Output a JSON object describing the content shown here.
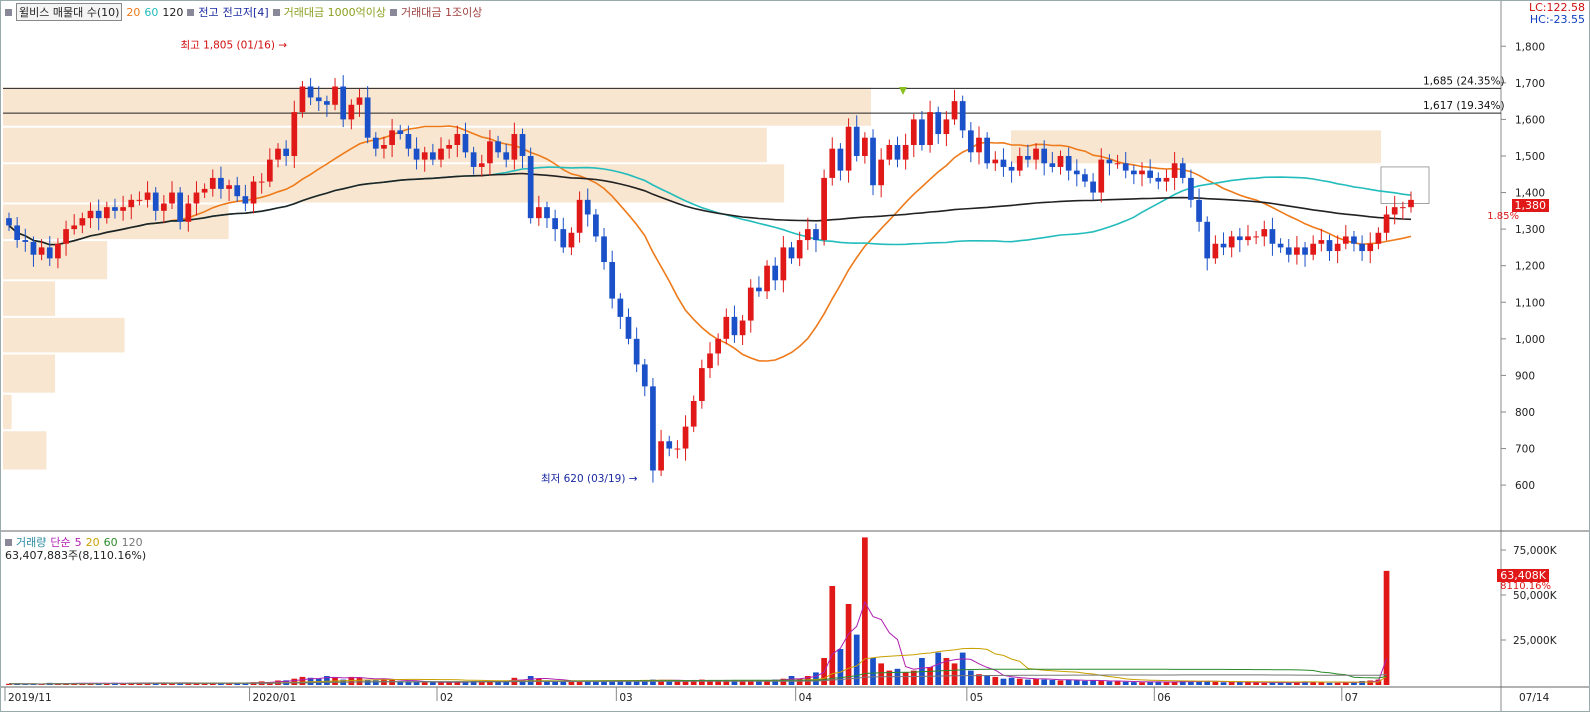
{
  "price_header": {
    "title": "윌비스 매물대 수(10)",
    "ma_periods": [
      "20",
      "60",
      "120"
    ],
    "ma_colors": [
      "#ee7a1a",
      "#22bcbc",
      "#222222"
    ],
    "items": [
      "전고",
      "전고저[4]",
      "거래대금 1000억이상",
      "거래대금 1조이상"
    ],
    "lc": "LC:122.58",
    "hc": "HC:-23.55"
  },
  "volume_header": {
    "title": "거래량",
    "simple": "단순",
    "periods": [
      "5",
      "20",
      "60",
      "120"
    ],
    "period_colors": [
      "#b020b0",
      "#c8a000",
      "#2a8a2a",
      "#777777"
    ],
    "value": "63,407,883주(8,110.16%)"
  },
  "annotations": {
    "high": "최고 1,805 (01/16)",
    "low": "최저 620 (03/19)",
    "line1": "1,685 (24.35%)",
    "line2": "1,617 (19.34%)"
  },
  "price_tag": {
    "value": "1,380",
    "pct": "1.85%"
  },
  "volume_tag": {
    "value": "63,408K",
    "pct": "8110.16%"
  },
  "x_labels": [
    "2019/11",
    "2020/01",
    "02",
    "03",
    "04",
    "05",
    "06",
    "07"
  ],
  "x_right_label": "07/14",
  "chart_data": {
    "type": "candlestick",
    "price_axis": {
      "ylim": [
        480,
        1880
      ],
      "ticks": [
        600,
        700,
        800,
        900,
        1000,
        1100,
        1200,
        1300,
        1400,
        1500,
        1600,
        1700,
        1800
      ]
    },
    "volume_axis": {
      "ylim": [
        0,
        80000
      ],
      "ticks": [
        "25,000K",
        "50,000K",
        "75,000K"
      ],
      "tick_values": [
        25000,
        50000,
        75000
      ]
    },
    "horizontal_lines": [
      1685,
      1617
    ],
    "close": [
      1310,
      1270,
      1265,
      1230,
      1250,
      1220,
      1260,
      1300,
      1310,
      1330,
      1350,
      1330,
      1360,
      1350,
      1360,
      1380,
      1380,
      1400,
      1350,
      1370,
      1400,
      1320,
      1370,
      1400,
      1410,
      1440,
      1410,
      1420,
      1390,
      1370,
      1430,
      1430,
      1490,
      1520,
      1500,
      1620,
      1690,
      1660,
      1650,
      1640,
      1690,
      1600,
      1640,
      1660,
      1550,
      1520,
      1530,
      1570,
      1560,
      1520,
      1490,
      1510,
      1490,
      1520,
      1530,
      1560,
      1510,
      1470,
      1480,
      1540,
      1510,
      1490,
      1560,
      1500,
      1330,
      1360,
      1330,
      1300,
      1250,
      1290,
      1380,
      1340,
      1280,
      1210,
      1110,
      1060,
      1000,
      930,
      870,
      640,
      720,
      700,
      700,
      760,
      830,
      920,
      960,
      1000,
      1060,
      1010,
      1050,
      1140,
      1130,
      1200,
      1160,
      1250,
      1220,
      1270,
      1300,
      1270,
      1440,
      1520,
      1460,
      1580,
      1500,
      1550,
      1420,
      1490,
      1530,
      1490,
      1530,
      1600,
      1530,
      1620,
      1560,
      1600,
      1650,
      1570,
      1510,
      1550,
      1480,
      1490,
      1470,
      1460,
      1500,
      1490,
      1520,
      1480,
      1470,
      1500,
      1460,
      1450,
      1430,
      1400,
      1490,
      1480,
      1480,
      1460,
      1450,
      1460,
      1440,
      1430,
      1440,
      1480,
      1440,
      1380,
      1320,
      1220,
      1260,
      1250,
      1280,
      1270,
      1280,
      1280,
      1300,
      1260,
      1250,
      1230,
      1250,
      1230,
      1260,
      1270,
      1240,
      1260,
      1280,
      1260,
      1240,
      1260,
      1290,
      1340,
      1360,
      1360,
      1380
    ],
    "volume": [
      700,
      600,
      500,
      600,
      500,
      1200,
      800,
      900,
      1100,
      1000,
      900,
      800,
      1000,
      1200,
      900,
      1100,
      1000,
      1300,
      1200,
      1100,
      1000,
      1300,
      1200,
      900,
      800,
      1000,
      1300,
      1100,
      1200,
      1000,
      1500,
      2000,
      1600,
      2500,
      2600,
      3500,
      4500,
      4000,
      3500,
      5000,
      4200,
      3000,
      4500,
      4000,
      3000,
      2500,
      3500,
      2800,
      2000,
      1800,
      1600,
      1500,
      1400,
      1600,
      1800,
      1500,
      1700,
      2200,
      2000,
      2500,
      2000,
      2500,
      4000,
      3000,
      5000,
      3500,
      2500,
      2000,
      1800,
      2000,
      2500,
      2000,
      1800,
      2200,
      2500,
      2000,
      2200,
      2500,
      2500,
      3000,
      2800,
      2500,
      2200,
      2000,
      2800,
      3000,
      2500,
      2000,
      2500,
      2000,
      2200,
      2500,
      2800,
      2500,
      3000,
      3500,
      5000,
      3500,
      5000,
      7000,
      15000,
      55000,
      20000,
      45000,
      28000,
      82000,
      15000,
      12000,
      8000,
      9000,
      7000,
      8000,
      15000,
      10000,
      18000,
      15000,
      12000,
      18000,
      8000,
      6000,
      5000,
      4500,
      3500,
      4000,
      3500,
      3000,
      3500,
      3000,
      2800,
      2500,
      3000,
      2500,
      2300,
      2500,
      2200,
      2000,
      2000,
      1800,
      1600,
      1500,
      1800,
      2000,
      1500,
      1500,
      2500,
      2000,
      2200,
      2000,
      1800,
      1500,
      1600,
      1800,
      1500,
      1400,
      1200,
      1400,
      1500,
      1300,
      1600,
      2000,
      1800,
      1500,
      1200,
      1200,
      1400,
      1800,
      2200,
      2500,
      3000,
      63408
    ],
    "volume_profile": [
      {
        "price_bin": [
          1580,
          1690
        ],
        "volume_weight": 1.0
      },
      {
        "price_bin": [
          1480,
          1580
        ],
        "volume_weight": 0.88
      },
      {
        "price_bin": [
          1370,
          1480
        ],
        "volume_weight": 0.9
      },
      {
        "price_bin": [
          1270,
          1370
        ],
        "volume_weight": 0.26
      },
      {
        "price_bin": [
          1160,
          1270
        ],
        "volume_weight": 0.12
      },
      {
        "price_bin": [
          1060,
          1160
        ],
        "volume_weight": 0.06
      },
      {
        "price_bin": [
          960,
          1060
        ],
        "volume_weight": 0.14
      },
      {
        "price_bin": [
          850,
          960
        ],
        "volume_weight": 0.06
      },
      {
        "price_bin": [
          750,
          850
        ],
        "volume_weight": 0.01
      },
      {
        "price_bin": [
          640,
          750
        ],
        "volume_weight": 0.05
      }
    ]
  }
}
